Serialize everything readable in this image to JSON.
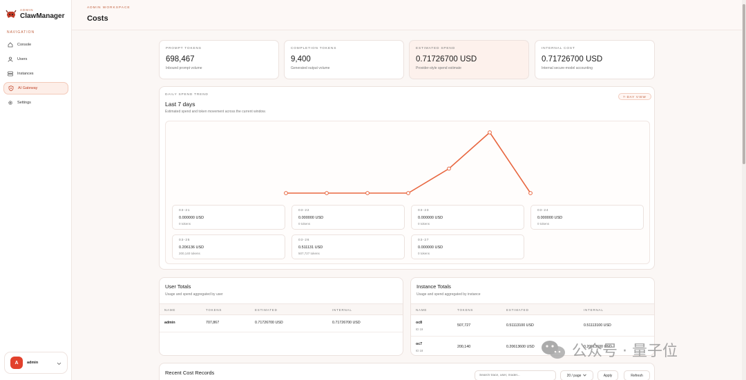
{
  "sidebar": {
    "brand_kicker": "ADMIN",
    "brand_name": "ClawManager",
    "nav_heading": "NAVIGATION",
    "items": [
      {
        "label": "Console",
        "icon": "home-icon",
        "active": false
      },
      {
        "label": "Users",
        "icon": "user-icon",
        "active": false
      },
      {
        "label": "Instances",
        "icon": "server-icon",
        "active": false
      },
      {
        "label": "AI Gateway",
        "icon": "shield-icon",
        "active": true
      },
      {
        "label": "Settings",
        "icon": "gear-icon",
        "active": false
      }
    ],
    "user": {
      "avatar_letter": "A",
      "name": "admin"
    }
  },
  "header": {
    "kicker": "ADMIN WORKSPACE",
    "title": "Costs"
  },
  "stats": [
    {
      "label": "PROMPT TOKENS",
      "value": "698,467",
      "sub": "Inbound prompt volume"
    },
    {
      "label": "COMPLETION TOKENS",
      "value": "9,400",
      "sub": "Generated output volume"
    },
    {
      "label": "ESTIMATED SPEND",
      "value": "0.71726700 USD",
      "sub": "Provider-style spend estimate"
    },
    {
      "label": "INTERNAL COST",
      "value": "0.71726700 USD",
      "sub": "Internal secure-model accounting"
    }
  ],
  "trend": {
    "kicker": "DAILY SPEND TREND",
    "title": "Last 7 days",
    "subtitle": "Estimated spend and token movement across the current window.",
    "badge": "7-DAY VIEW"
  },
  "chart_data": {
    "type": "line",
    "title": "",
    "x": [
      "03-21",
      "03-22",
      "03-23",
      "03-24",
      "03-25",
      "03-26",
      "03-27"
    ],
    "series": [
      {
        "values": [
          0.0,
          0.0,
          0.0,
          0.0,
          0.206136,
          0.511131,
          0.0
        ]
      }
    ],
    "tokens": [
      0,
      0,
      0,
      0,
      200140,
      507727,
      0
    ],
    "color": "#e8663f",
    "grid": false
  },
  "days": [
    {
      "date": "03-21",
      "usd": "0.000000 USD",
      "tokens": "0 tokens"
    },
    {
      "date": "03-22",
      "usd": "0.000000 USD",
      "tokens": "0 tokens"
    },
    {
      "date": "03-23",
      "usd": "0.000000 USD",
      "tokens": "0 tokens"
    },
    {
      "date": "03-24",
      "usd": "0.000000 USD",
      "tokens": "0 tokens"
    },
    {
      "date": "03-25",
      "usd": "0.206136 USD",
      "tokens": "200,140 tokens"
    },
    {
      "date": "03-26",
      "usd": "0.511131 USD",
      "tokens": "507,727 tokens"
    },
    {
      "date": "03-27",
      "usd": "0.000000 USD",
      "tokens": "0 tokens"
    }
  ],
  "user_totals": {
    "title": "User Totals",
    "subtitle": "Usage and spend aggregated by user",
    "columns": [
      "NAME",
      "TOKENS",
      "ESTIMATED",
      "INTERNAL"
    ],
    "rows": [
      {
        "name": "admin",
        "tokens": "707,867",
        "estimated": "0.71726700 USD",
        "internal": "0.71726700 USD"
      }
    ]
  },
  "instance_totals": {
    "title": "Instance Totals",
    "subtitle": "Usage and spend aggregated by instance",
    "columns": [
      "NAME",
      "TOKENS",
      "ESTIMATED",
      "INTERNAL"
    ],
    "rows": [
      {
        "name": "oc8",
        "id": "ID 19",
        "tokens": "507,727",
        "estimated": "0.51113100 USD",
        "internal": "0.51113100 USD"
      },
      {
        "name": "oc7",
        "id": "ID 18",
        "tokens": "200,140",
        "estimated": "0.20613600 USD",
        "internal": "0.20613600 USD"
      }
    ]
  },
  "recent": {
    "title": "Recent Cost Records",
    "search_placeholder": "Search trace, user, model...",
    "page_size": "20 / page",
    "apply_label": "Apply",
    "refresh_label": "Refresh"
  },
  "watermark": {
    "text": "公众号 · 量子位"
  }
}
